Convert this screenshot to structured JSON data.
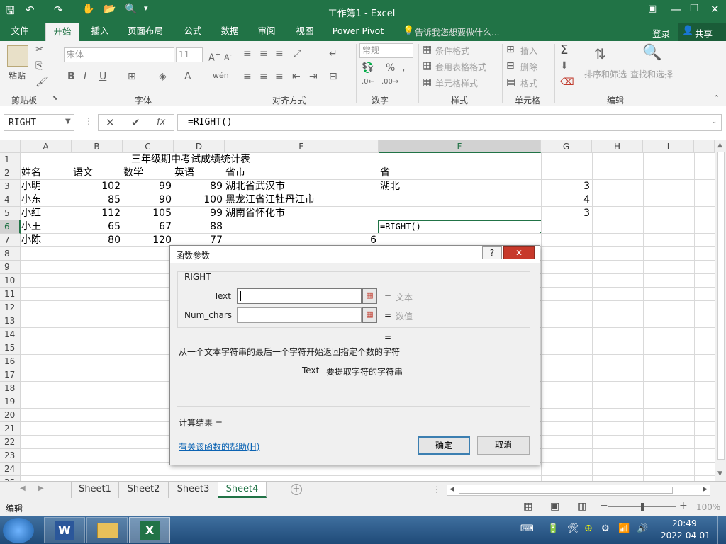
{
  "window": {
    "title": "工作簿1 - Excel"
  },
  "ribbon_tabs": [
    "文件",
    "开始",
    "插入",
    "页面布局",
    "公式",
    "数据",
    "审阅",
    "视图",
    "Power Pivot"
  ],
  "tell_me": "告诉我您想要做什么...",
  "account": {
    "login": "登录",
    "share": "共享"
  },
  "ribbon": {
    "clipboard": {
      "paste": "粘贴",
      "group": "剪贴板"
    },
    "font": {
      "name": "宋体",
      "size": "11",
      "bold": "B",
      "italic": "I",
      "underline": "U",
      "group": "字体"
    },
    "alignment": {
      "group": "对齐方式"
    },
    "number": {
      "format": "常规",
      "group": "数字"
    },
    "styles": {
      "conditional": "条件格式",
      "table": "套用表格格式",
      "cell": "单元格样式",
      "group": "样式"
    },
    "cells": {
      "insert": "插入",
      "delete": "删除",
      "format": "格式",
      "group": "单元格"
    },
    "editing": {
      "sort": "排序和筛选",
      "find": "查找和选择",
      "group": "编辑"
    }
  },
  "formula_bar": {
    "name_box": "RIGHT",
    "formula": "=RIGHT()"
  },
  "columns": [
    "A",
    "B",
    "C",
    "D",
    "E",
    "F",
    "G",
    "H",
    "I"
  ],
  "rows": [
    "1",
    "2",
    "3",
    "4",
    "5",
    "6",
    "7",
    "8",
    "9",
    "10",
    "11",
    "12",
    "13",
    "14",
    "15",
    "16",
    "17",
    "18",
    "19",
    "20",
    "21",
    "22",
    "23",
    "24",
    "25"
  ],
  "cells": {
    "title": "三年级期中考试成绩统计表",
    "headers": [
      "姓名",
      "语文",
      "数学",
      "英语",
      "省市",
      "省"
    ],
    "data": [
      {
        "name": "小明",
        "chinese": "102",
        "math": "99",
        "english": "89",
        "city": "湖北省武汉市",
        "province": "湖北",
        "g": "3"
      },
      {
        "name": "小东",
        "chinese": "85",
        "math": "90",
        "english": "100",
        "city": "黑龙江省江牡丹江市",
        "province": "",
        "g": "4"
      },
      {
        "name": "小红",
        "chinese": "112",
        "math": "105",
        "english": "99",
        "city": "湖南省怀化市",
        "province": "",
        "g": "3"
      },
      {
        "name": "小王",
        "chinese": "65",
        "math": "67",
        "english": "88",
        "city": "",
        "province": "=RIGHT()",
        "g": ""
      },
      {
        "name": "小陈",
        "chinese": "80",
        "math": "120",
        "english": "77",
        "city": "6",
        "province": "",
        "g": ""
      }
    ]
  },
  "dialog": {
    "title": "函数参数",
    "function": "RIGHT",
    "arg1_label": "Text",
    "arg1_hint": "文本",
    "arg2_label": "Num_chars",
    "arg2_hint": "数值",
    "eq": "=",
    "description": "从一个文本字符串的最后一个字符开始返回指定个数的字符",
    "arg_desc_name": "Text",
    "arg_desc": "要提取字符的字符串",
    "result_label": "计算结果 =",
    "help_link": "有关该函数的帮助(H)",
    "ok": "确定",
    "cancel": "取消",
    "help_btn": "?",
    "close_btn": "✕"
  },
  "sheets": [
    "Sheet1",
    "Sheet2",
    "Sheet3",
    "Sheet4"
  ],
  "active_sheet": "Sheet4",
  "status": {
    "mode": "编辑",
    "zoom": "100%"
  },
  "taskbar": {
    "time": "20:49",
    "date": "2022-04-01"
  }
}
